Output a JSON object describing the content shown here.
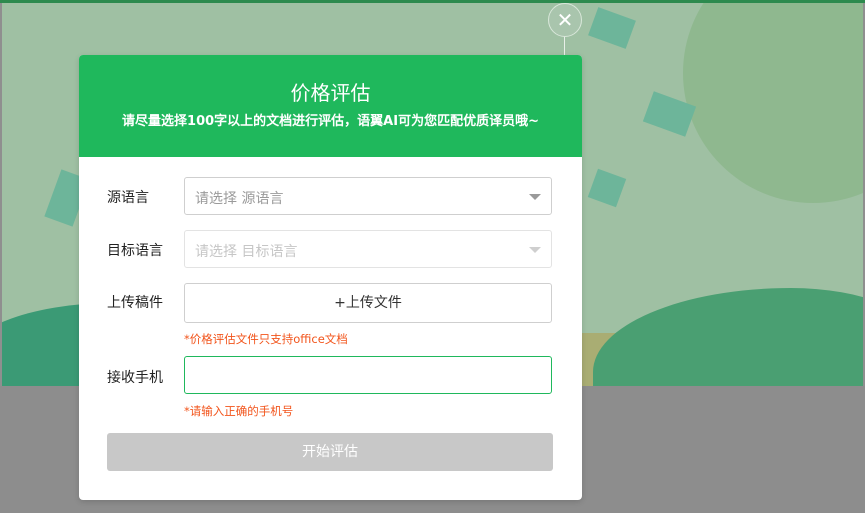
{
  "modal": {
    "title": "价格评估",
    "subtitle": "请尽量选择100字以上的文档进行评估，语翼AI可为您匹配优质译员哦~",
    "close_symbol": "✕"
  },
  "form": {
    "source_language": {
      "label": "源语言",
      "placeholder": "请选择 源语言"
    },
    "target_language": {
      "label": "目标语言",
      "placeholder": "请选择 目标语言"
    },
    "upload": {
      "label": "上传稿件",
      "button": "+上传文件",
      "hint": "*价格评估文件只支持office文档"
    },
    "phone": {
      "label": "接收手机",
      "value": "",
      "hint": "*请输入正确的手机号"
    },
    "submit_label": "开始评估"
  },
  "colors": {
    "brand_green": "#1fb85c",
    "error_orange": "#f2541b",
    "disabled_button": "#c8c8c8"
  }
}
